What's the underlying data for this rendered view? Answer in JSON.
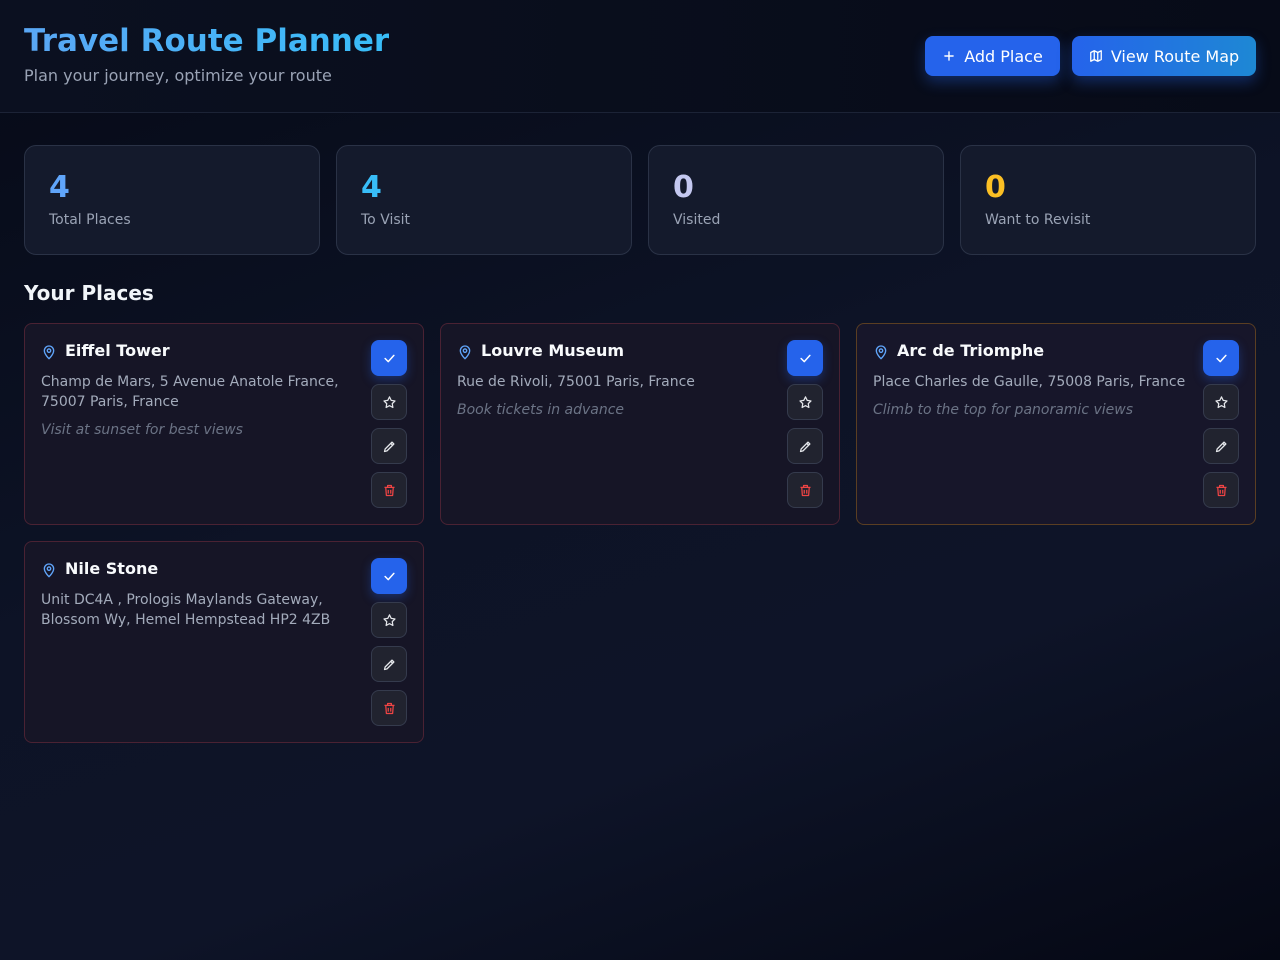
{
  "header": {
    "title": "Travel Route Planner",
    "subtitle": "Plan your journey, optimize your route",
    "add_button_label": "Add Place",
    "map_button_label": "View Route Map"
  },
  "stats": [
    {
      "value": "4",
      "label": "Total Places",
      "color": "#60a5fa"
    },
    {
      "value": "4",
      "label": "To Visit",
      "color": "#38bdf8"
    },
    {
      "value": "0",
      "label": "Visited",
      "color": "#c4c8f0"
    },
    {
      "value": "0",
      "label": "Want to Revisit",
      "color": "#fbbf24"
    }
  ],
  "section_title": "Your Places",
  "places": [
    {
      "name": "Eiffel Tower",
      "address": "Champ de Mars, 5 Avenue Anatole France, 75007 Paris, France",
      "notes": "Visit at sunset for best views"
    },
    {
      "name": "Louvre Museum",
      "address": "Rue de Rivoli, 75001 Paris, France",
      "notes": "Book tickets in advance"
    },
    {
      "name": "Arc de Triomphe",
      "address": "Place Charles de Gaulle, 75008 Paris, France",
      "notes": "Climb to the top for panoramic views"
    },
    {
      "name": "Nile Stone",
      "address": "Unit DC4A , Prologis Maylands Gateway, Blossom Wy, Hemel Hempstead HP2 4ZB",
      "notes": ""
    }
  ],
  "icons": {
    "add": "plus-icon",
    "map": "map-icon",
    "pin": "map-pin-icon",
    "visited": "check-icon",
    "revisit": "star-icon",
    "edit": "pencil-icon",
    "delete": "trash-icon"
  },
  "colors": {
    "accent": "#2563eb",
    "delete": "#ef4444"
  }
}
